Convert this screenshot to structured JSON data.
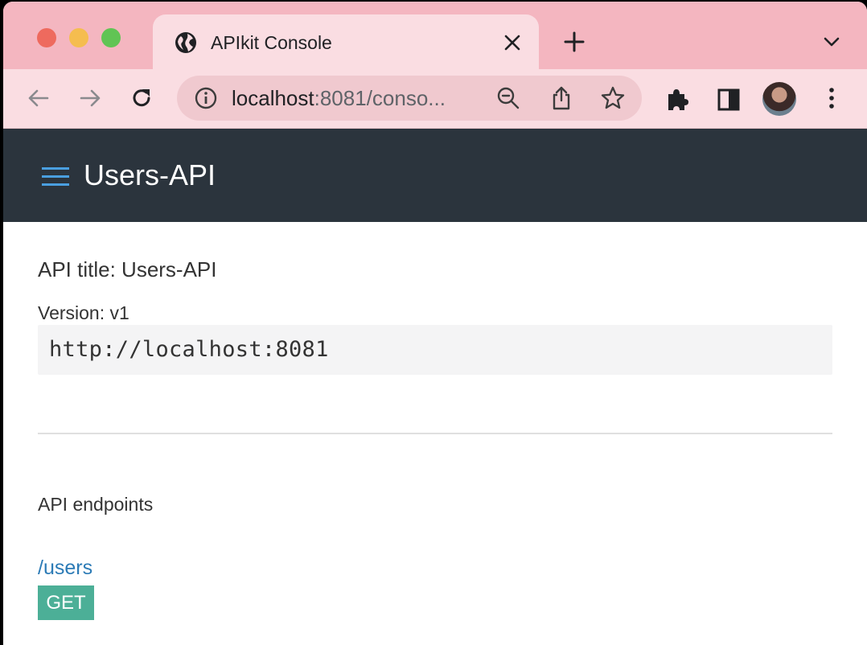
{
  "browser": {
    "tab_title": "APIkit Console",
    "url_host": "localhost",
    "url_rest": ":8081/conso...",
    "icons": [
      "globe-icon",
      "close-icon",
      "plus-icon",
      "chevron-down-icon",
      "back-arrow-icon",
      "forward-arrow-icon",
      "reload-icon",
      "info-icon",
      "zoom-out-icon",
      "share-icon",
      "star-icon",
      "puzzle-icon",
      "sidepanel-icon",
      "kebab-menu-icon"
    ]
  },
  "app": {
    "header_title": "Users-API",
    "api_title": "API title: Users-API",
    "version": "Version: v1",
    "base_uri": "http://localhost:8081",
    "endpoints_heading": "API endpoints",
    "endpoints": [
      {
        "path": "/users",
        "methods": [
          "GET"
        ]
      }
    ]
  },
  "colors": {
    "tabstrip": "#f4b6c0",
    "toolbar": "#fadde2",
    "header_bg": "#2b343d",
    "menu_icon": "#4a9fe0",
    "link": "#2c7bb6",
    "get_badge": "#4caf97"
  }
}
